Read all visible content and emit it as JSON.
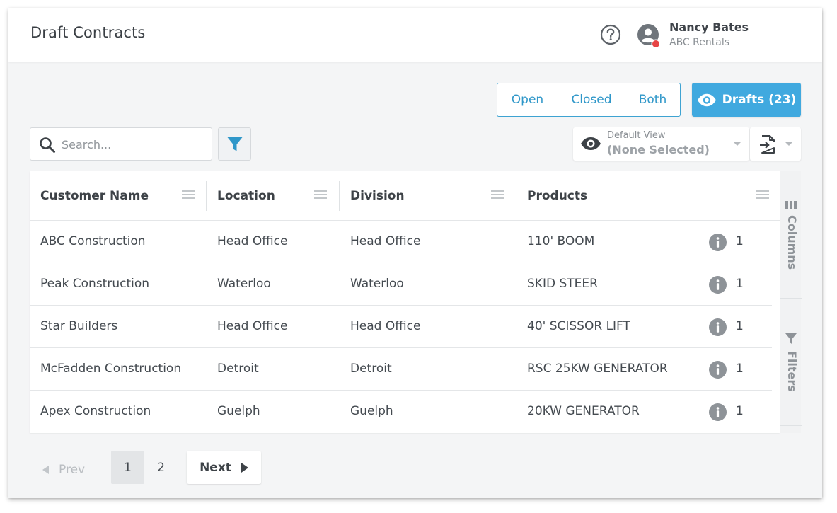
{
  "header": {
    "title": "Draft Contracts",
    "user_name": "Nancy Bates",
    "user_company": "ABC Rentals",
    "status_dot_color": "#e64545"
  },
  "toggle": {
    "options": [
      "Open",
      "Closed",
      "Both"
    ]
  },
  "drafts_button": {
    "label": "Drafts (23)",
    "icon": "eye-icon"
  },
  "search": {
    "placeholder": "Search...",
    "value": ""
  },
  "view_selector": {
    "label": "Default View",
    "value": "(None Selected)"
  },
  "table": {
    "columns": [
      "Customer Name",
      "Location",
      "Division",
      "Products"
    ],
    "rows": [
      {
        "customer": "ABC Construction",
        "location": "Head Office",
        "division": "Head Office",
        "product": "110' BOOM",
        "qty": "1"
      },
      {
        "customer": "Peak Construction",
        "location": "Waterloo",
        "division": "Waterloo",
        "product": "SKID STEER",
        "qty": "1"
      },
      {
        "customer": "Star Builders",
        "location": "Head Office",
        "division": "Head Office",
        "product": "40' SCISSOR LIFT",
        "qty": "1"
      },
      {
        "customer": "McFadden Construction",
        "location": "Detroit",
        "division": "Detroit",
        "product": "RSC 25KW GENERATOR",
        "qty": "1"
      },
      {
        "customer": "Apex Construction",
        "location": "Guelph",
        "division": "Guelph",
        "product": "20KW GENERATOR",
        "qty": "1"
      }
    ]
  },
  "side_panel": {
    "columns_label": "Columns",
    "filters_label": "Filters"
  },
  "pagination": {
    "prev_label": "Prev",
    "pages": [
      "1",
      "2"
    ],
    "current": "1",
    "next_label": "Next"
  },
  "colors": {
    "accent": "#40a9df",
    "accent_border": "#3ea3d2",
    "icon_gray": "#8e9398"
  }
}
